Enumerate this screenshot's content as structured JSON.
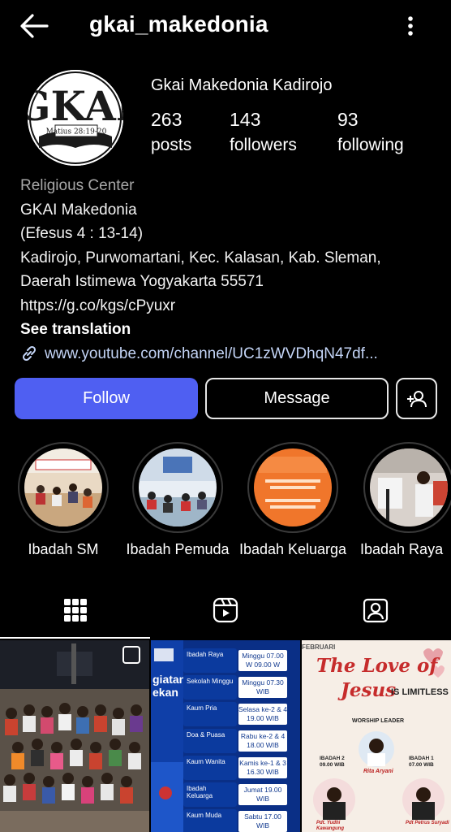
{
  "header": {
    "username": "gkai_makedonia"
  },
  "profile": {
    "avatar_logo_text": "GKAI",
    "avatar_verse_text": "Matius 28:19-20",
    "display_name": "Gkai Makedonia Kadirojo",
    "stats": [
      {
        "value": "263",
        "label": "posts"
      },
      {
        "value": "143",
        "label": "followers"
      },
      {
        "value": "93",
        "label": "following"
      }
    ]
  },
  "bio": {
    "category": "Religious Center",
    "lines": [
      "GKAI Makedonia",
      "(Efesus 4 : 13-14)",
      "Kadirojo, Purwomartani, Kec. Kalasan, Kab. Sleman,",
      "Daerah Istimewa Yogyakarta 55571",
      "https://g.co/kgs/cPyuxr"
    ],
    "see_translation": "See translation",
    "link": "www.youtube.com/channel/UC1zWVDhqN47df..."
  },
  "actions": {
    "follow_label": "Follow",
    "message_label": "Message"
  },
  "highlights": [
    {
      "label": "Ibadah SM"
    },
    {
      "label": "Ibadah Pemuda"
    },
    {
      "label": "Ibadah Keluarga"
    },
    {
      "label": "Ibadah Raya"
    }
  ],
  "tabs": [
    {
      "icon": "grid-icon"
    },
    {
      "icon": "reels-icon"
    },
    {
      "icon": "tagged-icon"
    }
  ],
  "posts": {
    "schedule": {
      "side_title": "giatan ekan",
      "rows": [
        {
          "label": "Ibadah Raya",
          "value": "Minggu 07.00 W 09.00 W"
        },
        {
          "label": "Sekolah Minggu",
          "value": "Minggu 07.30 WIB"
        },
        {
          "label": "Kaum Pria",
          "value": "Selasa ke-2 & 4 19.00 WIB"
        },
        {
          "label": "Doa & Puasa",
          "value": "Rabu ke-2 & 4 18.00 WIB"
        },
        {
          "label": "Kaum Wanita",
          "value": "Kamis ke-1 & 3 16.30 WIB"
        },
        {
          "label": "Ibadah Keluarga",
          "value": "Jumat 19.00 WIB"
        },
        {
          "label": "Kaum Muda",
          "value": "Sabtu 17.00 WIB"
        }
      ]
    },
    "love": {
      "month": "FEBRUARI",
      "title_a": "The Love of",
      "title_b": "Jesus",
      "title_c": "IS LIMITLESS",
      "worship_leader": "WORSHIP LEADER",
      "wl_name": "Rita Aryani",
      "ibadah2": "IBADAH 2 09.00 WIB",
      "ibadah1": "IBADAH 1 07.00 WIB",
      "pdt1": "Pdt. Yudhi Kawangung",
      "pdt2": "Pdt Petrus Suryadi"
    }
  },
  "colors": {
    "follow_button": "#4f5ff2",
    "link": "#c4d5f7",
    "category": "#a8a8a8",
    "background": "#000000"
  }
}
